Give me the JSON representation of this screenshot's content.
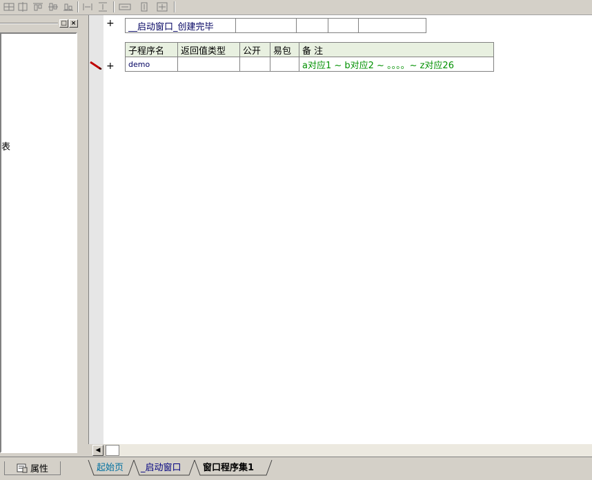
{
  "editor": {
    "window_name": "__启动窗口_创建完毕",
    "table_headers": [
      "子程序名",
      "返回值类型",
      "公开",
      "易包",
      "备 注"
    ],
    "sub_name": "demo",
    "sub_comment": "a对应1 ~ b对应2 ~ 。。。。~ z对应26",
    "plus_symbol": "+"
  },
  "left_panel": {
    "fragment_text": "表"
  },
  "bottom": {
    "properties_tab": "属性",
    "tabs": [
      {
        "label": "起始页",
        "active": false,
        "color": "#0070a0"
      },
      {
        "label": "_启动窗口",
        "active": false,
        "color": "#000080"
      },
      {
        "label": "窗口程序集1",
        "active": true,
        "color": "#000000"
      }
    ]
  },
  "colors": {
    "comment": "#009000",
    "header_bg": "#e8f0e0",
    "pen": "#c00000"
  }
}
